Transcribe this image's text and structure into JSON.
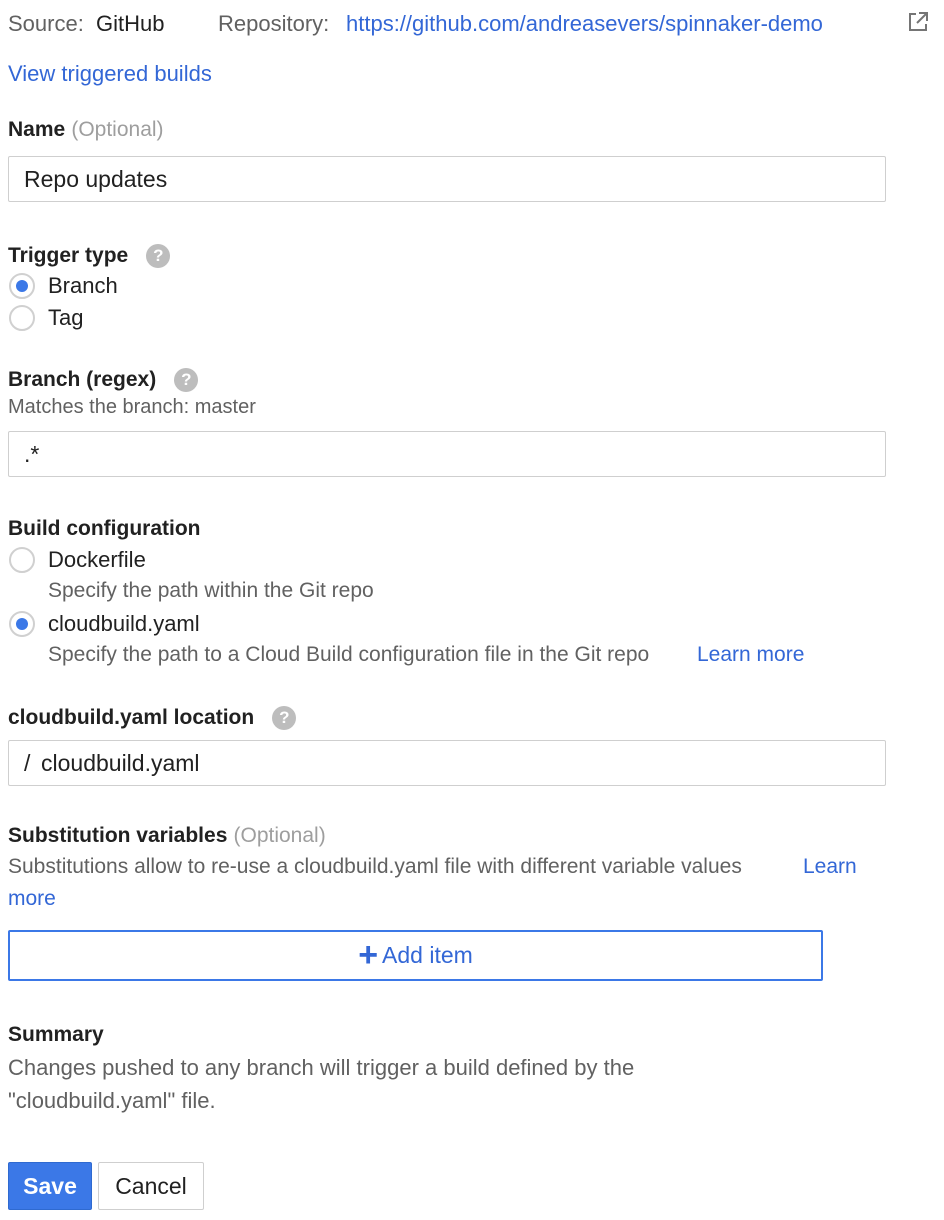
{
  "source": {
    "label": "Source:",
    "value": "GitHub",
    "repo_label": "Repository:",
    "repo_url": "https://github.com/andreasevers/spinnaker-demo",
    "external_icon": "external-link-icon"
  },
  "view_builds_link": "View triggered builds",
  "name": {
    "label": "Name",
    "optional": "(Optional)",
    "value": "Repo updates"
  },
  "trigger_type": {
    "label": "Trigger type",
    "help_icon": "?",
    "options": [
      {
        "label": "Branch",
        "selected": true
      },
      {
        "label": "Tag",
        "selected": false
      }
    ]
  },
  "branch": {
    "label": "Branch (regex)",
    "help_icon": "?",
    "hint": "Matches the branch: master",
    "value": ".*"
  },
  "build_config": {
    "label": "Build configuration",
    "options": [
      {
        "label": "Dockerfile",
        "description": "Specify the path within the Git repo",
        "selected": false
      },
      {
        "label": "cloudbuild.yaml",
        "description": "Specify the path to a Cloud Build configuration file in the Git repo",
        "selected": true,
        "link": "Learn more"
      }
    ]
  },
  "location": {
    "label": "cloudbuild.yaml location",
    "help_icon": "?",
    "prefix": "/",
    "value": "cloudbuild.yaml"
  },
  "substitution": {
    "label": "Substitution variables",
    "optional": "(Optional)",
    "description": "Substitutions allow to re-use a cloudbuild.yaml file with different variable values",
    "link_line1": "Learn",
    "link_line2": "more",
    "add_icon": "+",
    "add_label": "Add item"
  },
  "summary": {
    "label": "Summary",
    "line1": "Changes pushed to any branch will trigger a build defined by the",
    "line2": "\"cloudbuild.yaml\" file."
  },
  "actions": {
    "save": "Save",
    "cancel": "Cancel"
  },
  "colors": {
    "accent": "#3367d6",
    "radio_fill": "#3b78e7",
    "save_bg": "#3b78e7"
  }
}
